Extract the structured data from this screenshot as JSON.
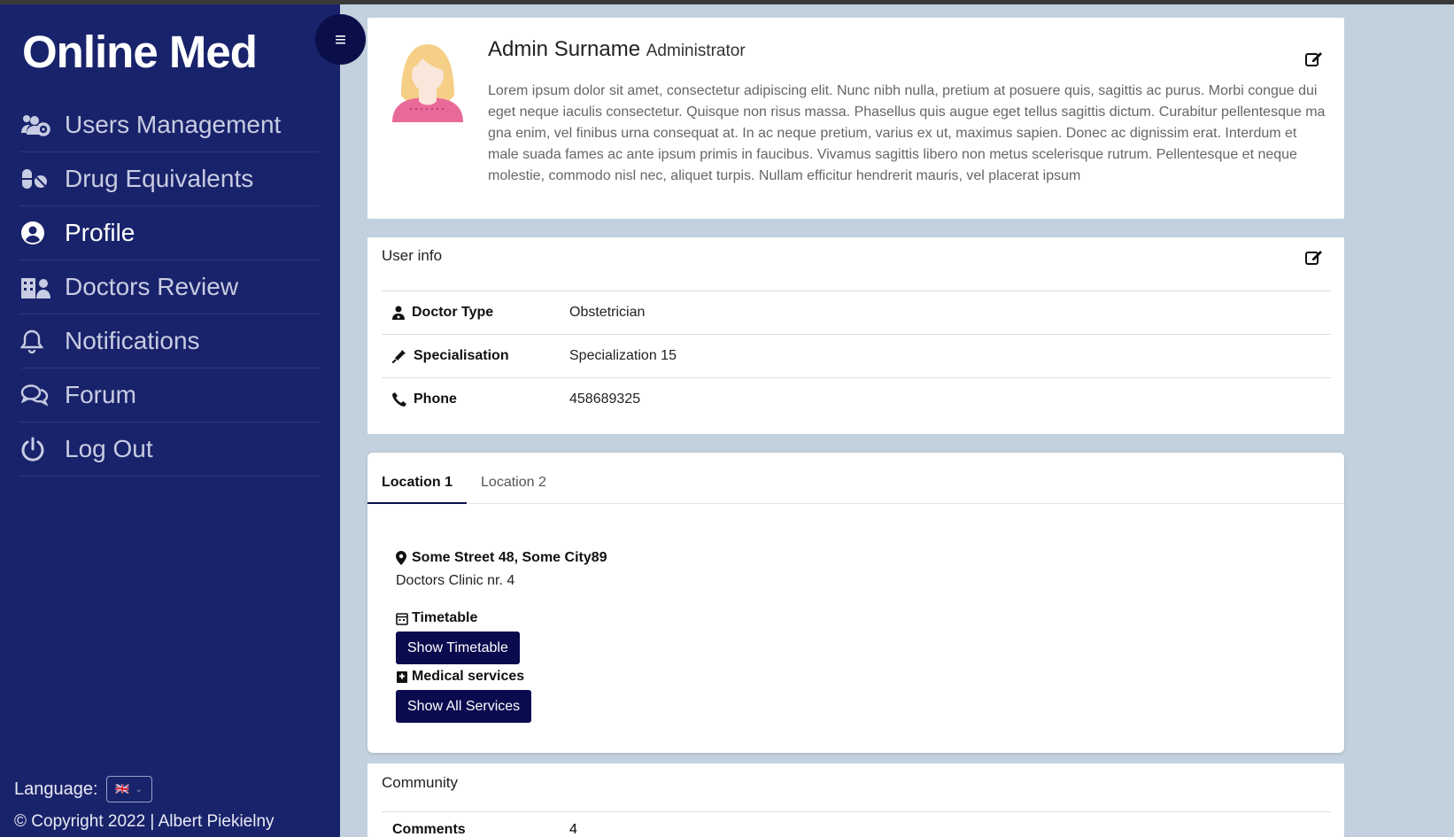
{
  "app": {
    "title": "Online Med"
  },
  "sidebar": {
    "items": [
      {
        "label": "Users Management",
        "icon": "users-cog-icon"
      },
      {
        "label": "Drug Equivalents",
        "icon": "pills-icon"
      },
      {
        "label": "Profile",
        "icon": "user-circle-icon",
        "active": true
      },
      {
        "label": "Doctors Review",
        "icon": "clinic-users-icon"
      },
      {
        "label": "Notifications",
        "icon": "bell-icon"
      },
      {
        "label": "Forum",
        "icon": "comments-icon"
      },
      {
        "label": "Log Out",
        "icon": "power-icon"
      }
    ],
    "language_label": "Language:",
    "language_flag": "🇬🇧",
    "copyright": "© Copyright 2022 | Albert Piekielny"
  },
  "profile": {
    "name": "Admin Surname",
    "role": "Administrator",
    "description": "Lorem ipsum dolor sit amet, consectetur adipiscing elit. Nunc nibh nulla, pretium at posuere quis, sagittis ac purus. Morbi congue dui eget neque iaculis consectetur. Quisque non risus massa. Phasellus quis augue eget tellus sagittis dictum. Curabitur pellentesque ma gna enim, vel finibus urna consequat at. In ac neque pretium, varius ex ut, maximus sapien. Donec ac dignissim erat. Interdum et male suada fames ac ante ipsum primis in faucibus. Vivamus sagittis libero non metus scelerisque rutrum. Pellentesque et neque molestie, commodo nisl nec, aliquet turpis. Nullam efficitur hendrerit mauris, vel placerat ipsum"
  },
  "user_info": {
    "title": "User info",
    "rows": [
      {
        "key": "Doctor Type",
        "value": "Obstetrician",
        "icon": "user-md-icon"
      },
      {
        "key": "Specialisation",
        "value": "Specialization 15",
        "icon": "syringe-icon"
      },
      {
        "key": "Phone",
        "value": "458689325",
        "icon": "phone-icon"
      }
    ]
  },
  "locations": {
    "tabs": [
      "Location 1",
      "Location 2"
    ],
    "address": "Some Street 48, Some City89",
    "clinic": "Doctors Clinic nr. 4",
    "timetable_label": "Timetable",
    "timetable_button": "Show Timetable",
    "services_label": "Medical services",
    "services_button": "Show All Services"
  },
  "community": {
    "title": "Community",
    "comments_label": "Comments",
    "comments_value": "4"
  }
}
